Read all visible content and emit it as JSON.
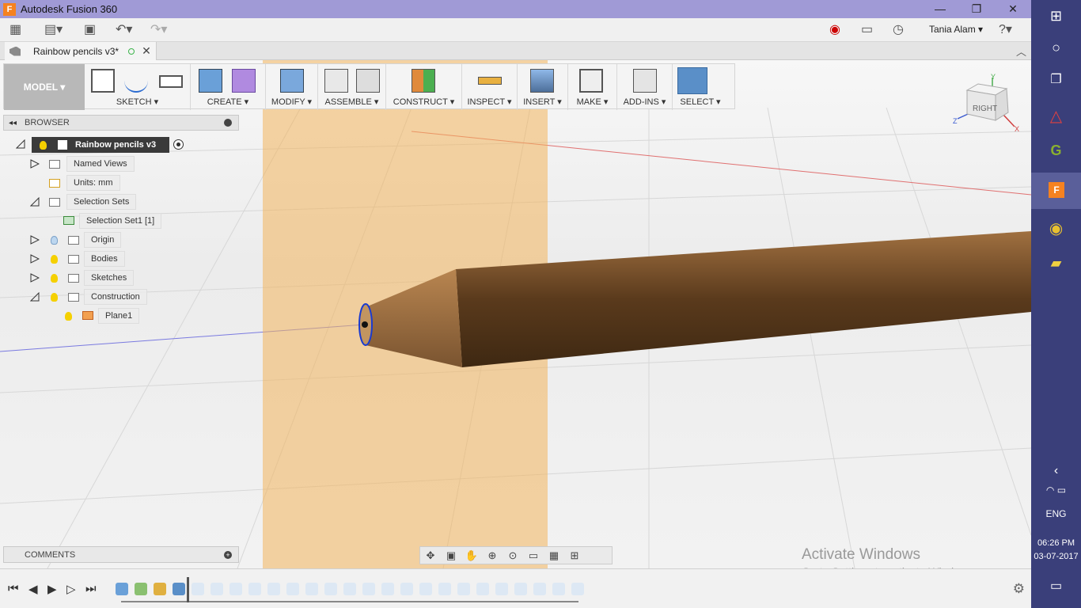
{
  "window": {
    "title": "Autodesk Fusion 360",
    "app_icon": "F",
    "controls": {
      "minimize": "—",
      "maximize": "❐",
      "close": "✕"
    }
  },
  "quick_access": {
    "user_name": "Tania Alam",
    "icons": [
      "apps-grid-icon",
      "file-icon",
      "save-icon",
      "undo-icon",
      "redo-icon",
      "record-icon",
      "comment-icon",
      "clock-icon",
      "help-icon"
    ]
  },
  "document_tab": {
    "label": "Rainbow pencils v3*"
  },
  "workspace": {
    "label": "MODEL"
  },
  "toolbar": {
    "groups": [
      "SKETCH",
      "CREATE",
      "MODIFY",
      "ASSEMBLE",
      "CONSTRUCT",
      "INSPECT",
      "INSERT",
      "MAKE",
      "ADD-INS",
      "SELECT"
    ]
  },
  "viewcube": {
    "face": "RIGHT",
    "axes": [
      "Y",
      "Z",
      "X"
    ]
  },
  "browser": {
    "title": "BROWSER",
    "items": [
      {
        "label": "Rainbow pencils v3"
      },
      {
        "label": "Named Views"
      },
      {
        "label": "Units: mm"
      },
      {
        "label": "Selection Sets"
      },
      {
        "label": "Selection Set1 [1]"
      },
      {
        "label": "Origin"
      },
      {
        "label": "Bodies"
      },
      {
        "label": "Sketches"
      },
      {
        "label": "Construction"
      },
      {
        "label": "Plane1"
      }
    ]
  },
  "comments": {
    "label": "COMMENTS"
  },
  "watermark": {
    "line1": "Activate Windows",
    "line2": "Go to Settings to activate Windows."
  },
  "taskbar": {
    "language": "ENG",
    "time": "06:26 PM",
    "date": "03-07-2017"
  },
  "colors": {
    "titlebar": "#a09ad6",
    "plane": "#f2b45c",
    "pencil_wood": "#6b4423",
    "taskbar": "#3a3f7a"
  }
}
